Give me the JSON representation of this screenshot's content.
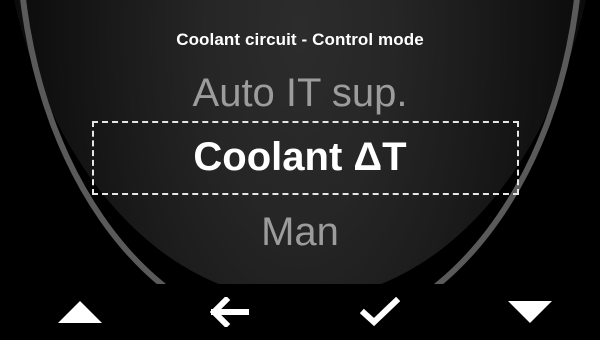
{
  "header": {
    "title": "Coolant circuit - Control mode"
  },
  "menu": {
    "options": [
      {
        "label": "Auto IT sup.",
        "state": "previous"
      },
      {
        "label": "Coolant ΔT",
        "state": "selected"
      },
      {
        "label": "Man",
        "state": "next"
      }
    ]
  },
  "navbar": {
    "buttons": [
      {
        "name": "up",
        "icon": "triangle-up-icon"
      },
      {
        "name": "back",
        "icon": "arrow-left-icon"
      },
      {
        "name": "confirm",
        "icon": "checkmark-icon"
      },
      {
        "name": "down",
        "icon": "triangle-down-icon"
      }
    ]
  },
  "colors": {
    "background": "#000000",
    "text_primary": "#ffffff",
    "text_secondary": "#9c9c9c",
    "ring": "#5a5a5a"
  }
}
